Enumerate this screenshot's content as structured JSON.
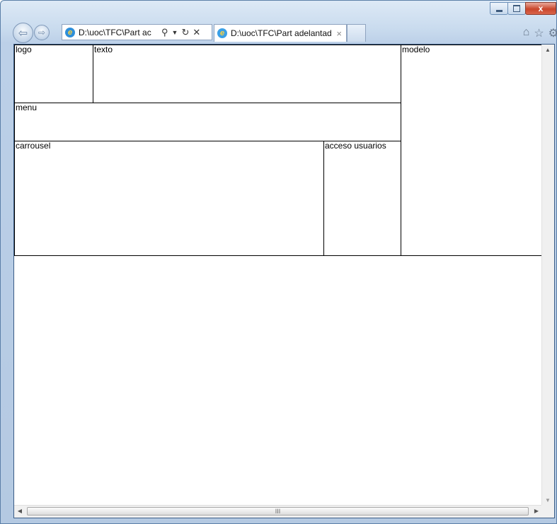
{
  "window": {
    "minimize_icon": "minimize-icon",
    "maximize_icon": "maximize-icon",
    "close_label": "x"
  },
  "navigation": {
    "back_icon": "back-arrow-icon",
    "forward_icon": "forward-arrow-icon"
  },
  "address_bar": {
    "text": "D:\\uoc\\TFC\\Part ac",
    "search_icon": "search-icon",
    "dropdown_icon": "chevron-down-icon",
    "refresh_icon": "refresh-icon",
    "stop_icon": "stop-icon"
  },
  "tabs": [
    {
      "title": "D:\\uoc\\TFC\\Part adelantad...",
      "close": "×"
    }
  ],
  "toolbar_icons": [
    "home-icon",
    "favorites-icon",
    "tools-icon"
  ],
  "page": {
    "boxes": {
      "logo": "logo",
      "texto": "texto",
      "modelo": "modelo",
      "menu": "menu",
      "carrousel": "carrousel",
      "acceso": "acceso usuarios"
    }
  },
  "scrollbar": {
    "grip": "III"
  }
}
